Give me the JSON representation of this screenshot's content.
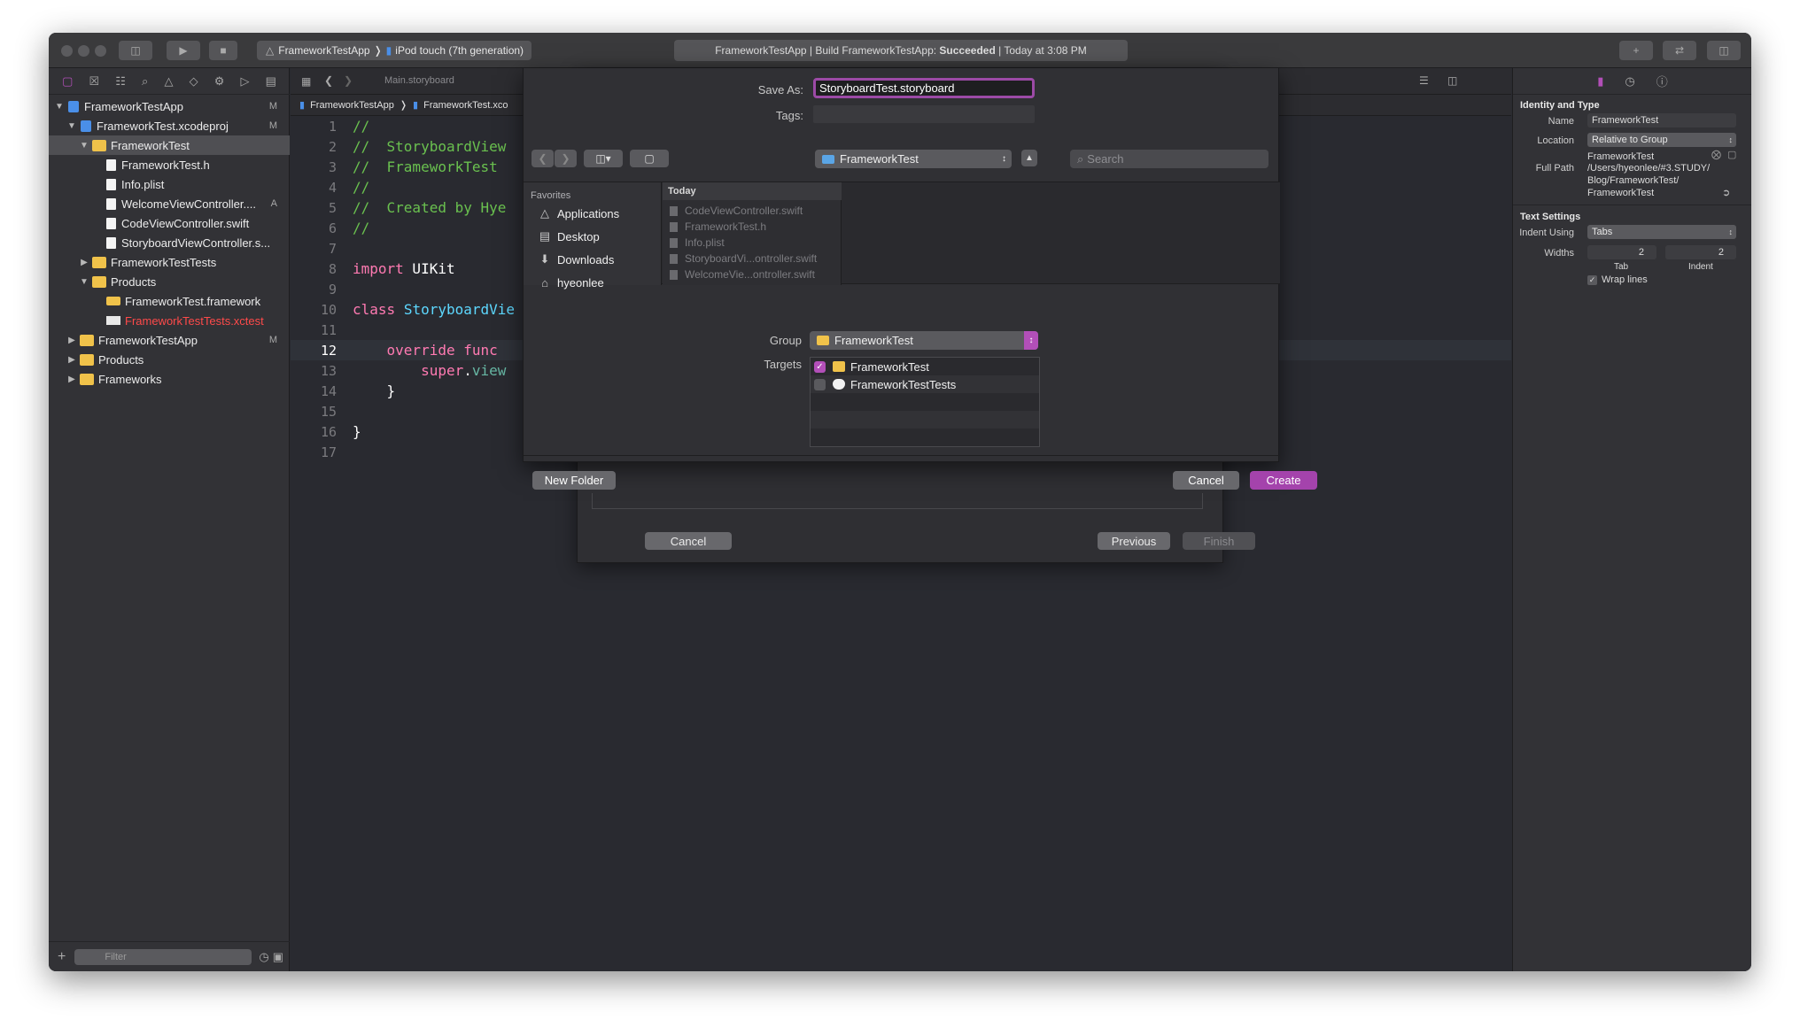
{
  "toolbar": {
    "scheme_target": "FrameworkTestApp",
    "scheme_device": "iPod touch (7th generation)",
    "activity_prefix": "FrameworkTestApp | Build FrameworkTestApp: ",
    "activity_status": "Succeeded",
    "activity_suffix": " | Today at 3:08 PM"
  },
  "navigator": {
    "items": [
      {
        "label": "FrameworkTestApp",
        "badge": "M"
      },
      {
        "label": "FrameworkTest.xcodeproj",
        "badge": "M"
      },
      {
        "label": "FrameworkTest",
        "badge": ""
      },
      {
        "label": "FrameworkTest.h",
        "badge": ""
      },
      {
        "label": "Info.plist",
        "badge": ""
      },
      {
        "label": "WelcomeViewController....",
        "badge": "A"
      },
      {
        "label": "CodeViewController.swift",
        "badge": ""
      },
      {
        "label": "StoryboardViewController.s...",
        "badge": ""
      },
      {
        "label": "FrameworkTestTests",
        "badge": ""
      },
      {
        "label": "Products",
        "badge": ""
      },
      {
        "label": "FrameworkTest.framework",
        "badge": ""
      },
      {
        "label": "FrameworkTestTests.xctest",
        "badge": ""
      },
      {
        "label": "FrameworkTestApp",
        "badge": "M"
      },
      {
        "label": "Products",
        "badge": ""
      },
      {
        "label": "Frameworks",
        "badge": ""
      }
    ],
    "filter_placeholder": "Filter"
  },
  "editor": {
    "tab": "Main.storyboard",
    "jumpbar": [
      "FrameworkTestApp",
      "FrameworkTest.xco"
    ],
    "lines": [
      {
        "n": "1",
        "p1": "//",
        "p2": "",
        "p3": "",
        "p4": ""
      },
      {
        "n": "2",
        "p1": "//  StoryboardView",
        "p2": "",
        "p3": "",
        "p4": ""
      },
      {
        "n": "3",
        "p1": "//  FrameworkTest",
        "p2": "",
        "p3": "",
        "p4": ""
      },
      {
        "n": "4",
        "p1": "//",
        "p2": "",
        "p3": "",
        "p4": ""
      },
      {
        "n": "5",
        "p1": "//  Created by Hye",
        "p2": "",
        "p3": "",
        "p4": ""
      },
      {
        "n": "6",
        "p1": "//",
        "p2": "",
        "p3": "",
        "p4": ""
      },
      {
        "n": "7",
        "p1": "",
        "p2": "",
        "p3": "",
        "p4": ""
      },
      {
        "n": "8",
        "p1": "",
        "p2": "import",
        "p3": " UIKit",
        "p4": ""
      },
      {
        "n": "9",
        "p1": "",
        "p2": "",
        "p3": "",
        "p4": ""
      },
      {
        "n": "10",
        "p1": "",
        "p2": "class",
        "p3": " ",
        "p4": "StoryboardVie"
      },
      {
        "n": "11",
        "p1": "",
        "p2": "",
        "p3": "",
        "p4": ""
      },
      {
        "n": "12",
        "p1": "",
        "p2": "    override func",
        "p3": "",
        "p4": ""
      },
      {
        "n": "13",
        "p1": "",
        "p2": "        super",
        "p3": ".",
        "p4": "view"
      },
      {
        "n": "14",
        "p1": "",
        "p2": "",
        "p3": "    }",
        "p4": ""
      },
      {
        "n": "15",
        "p1": "",
        "p2": "",
        "p3": "",
        "p4": ""
      },
      {
        "n": "16",
        "p1": "",
        "p2": "",
        "p3": "}",
        "p4": ""
      },
      {
        "n": "17",
        "p1": "",
        "p2": "",
        "p3": "",
        "p4": ""
      }
    ]
  },
  "inspector": {
    "identity_header": "Identity and Type",
    "name_label": "Name",
    "name_value": "FrameworkTest",
    "location_label": "Location",
    "location_value": "Relative to Group",
    "location_path": "FrameworkTest",
    "fullpath_label": "Full Path",
    "fullpath_line1": "/Users/hyeonlee/#3.STUDY/",
    "fullpath_line2": "Blog/FrameworkTest/",
    "fullpath_line3": "FrameworkTest",
    "text_header": "Text Settings",
    "indent_label": "Indent Using",
    "indent_value": "Tabs",
    "widths_label": "Widths",
    "tab_value": "2",
    "indent_value_num": "2",
    "tab_caption": "Tab",
    "indent_caption": "Indent",
    "wrap_label": "Wrap lines"
  },
  "template_sheet": {
    "cancel": "Cancel",
    "previous": "Previous",
    "finish": "Finish"
  },
  "save_sheet": {
    "save_as_label": "Save As:",
    "save_as_value": "StoryboardTest.storyboard",
    "tags_label": "Tags:",
    "location": "FrameworkTest",
    "search_placeholder": "Search",
    "favorites_header": "Favorites",
    "favorites": [
      "Applications",
      "Desktop",
      "Downloads",
      "hyeonlee"
    ],
    "column_header": "Today",
    "files": [
      "CodeViewController.swift",
      "FrameworkTest.h",
      "Info.plist",
      "StoryboardVi...ontroller.swift",
      "WelcomeVie...ontroller.swift"
    ],
    "group_label": "Group",
    "group_value": "FrameworkTest",
    "targets_label": "Targets",
    "targets": [
      {
        "name": "FrameworkTest",
        "checked": true
      },
      {
        "name": "FrameworkTestTests",
        "checked": false
      }
    ],
    "new_folder": "New Folder",
    "cancel": "Cancel",
    "create": "Create"
  },
  "colors": {
    "accent": "#b24fb8",
    "editor_bg": "#292a30",
    "comment": "#6ac14f",
    "keyword": "#ff7ab2",
    "type": "#5dd8ff"
  }
}
